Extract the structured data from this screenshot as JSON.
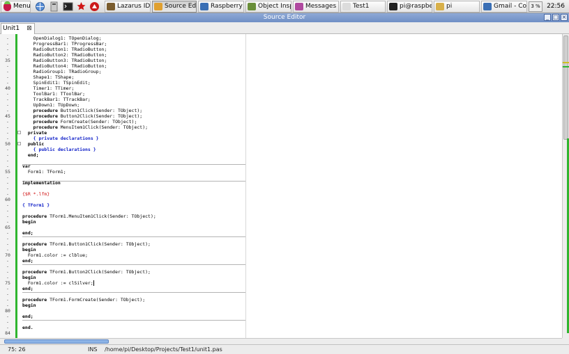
{
  "taskbar": {
    "menu_label": "Menu",
    "windows": [
      {
        "label": "Lazarus IDE...",
        "active": false,
        "icon": "lazarus-icon",
        "color": "#7a5c2e"
      },
      {
        "label": "Source Editor",
        "active": true,
        "icon": "source-editor-icon",
        "color": "#e0a030"
      },
      {
        "label": "Raspberry ...",
        "active": false,
        "icon": "browser-icon",
        "color": "#3a6fb5"
      },
      {
        "label": "Object Insp...",
        "active": false,
        "icon": "object-inspector-icon",
        "color": "#6a8f3a"
      },
      {
        "label": "Messages",
        "active": false,
        "icon": "messages-icon",
        "color": "#b04aa0"
      },
      {
        "label": "Test1",
        "active": false,
        "icon": "form-icon",
        "color": "#dcdcdc"
      },
      {
        "label": "pi@raspber...",
        "active": false,
        "icon": "terminal-icon",
        "color": "#222222"
      },
      {
        "label": "pi",
        "active": false,
        "icon": "folder-icon",
        "color": "#d8b04a"
      },
      {
        "label": "Gmail - Co...",
        "active": false,
        "icon": "browser-icon",
        "color": "#3a6fb5"
      }
    ],
    "cpu_label": "3 %",
    "clock": "22:56"
  },
  "window": {
    "title": "Source Editor"
  },
  "tab": {
    "label": "Unit1"
  },
  "editor": {
    "lines": [
      {
        "num": "-",
        "text": "    OpenDialog1: TOpenDialog;",
        "style": "plain"
      },
      {
        "num": "-",
        "text": "    ProgressBar1: TProgressBar;",
        "style": "plain"
      },
      {
        "num": "-",
        "text": "    RadioButton1: TRadioButton;",
        "style": "plain"
      },
      {
        "num": "-",
        "text": "    RadioButton2: TRadioButton;",
        "style": "plain"
      },
      {
        "num": "35",
        "text": "    RadioButton3: TRadioButton;",
        "style": "plain"
      },
      {
        "num": "-",
        "text": "    RadioButton4: TRadioButton;",
        "style": "plain"
      },
      {
        "num": "-",
        "text": "    RadioGroup1: TRadioGroup;",
        "style": "plain"
      },
      {
        "num": "-",
        "text": "    Shape1: TShape;",
        "style": "plain"
      },
      {
        "num": "-",
        "text": "    SpinEdit1: TSpinEdit;",
        "style": "plain"
      },
      {
        "num": "40",
        "text": "    Timer1: TTimer;",
        "style": "plain"
      },
      {
        "num": "-",
        "text": "    ToolBar1: TToolBar;",
        "style": "plain"
      },
      {
        "num": "-",
        "text": "    TrackBar1: TTrackBar;",
        "style": "plain"
      },
      {
        "num": "-",
        "text": "    UpDown1: TUpDown;",
        "style": "plain"
      },
      {
        "num": "-",
        "text": "    procedure Button1Click(Sender: TObject);",
        "style": "proc"
      },
      {
        "num": "45",
        "text": "    procedure Button2Click(Sender: TObject);",
        "style": "proc"
      },
      {
        "num": "-",
        "text": "    procedure FormCreate(Sender: TObject);",
        "style": "proc"
      },
      {
        "num": "-",
        "text": "    procedure MenuItem1Click(Sender: TObject);",
        "style": "proc"
      },
      {
        "num": "-",
        "text": "  private",
        "style": "kw",
        "fold": true
      },
      {
        "num": "-",
        "text": "    { private declarations }",
        "style": "cm"
      },
      {
        "num": "50",
        "text": "  public",
        "style": "kw",
        "fold": true
      },
      {
        "num": "-",
        "text": "    { public declarations }",
        "style": "cm"
      },
      {
        "num": "-",
        "text": "  end;",
        "style": "kw"
      },
      {
        "num": "-",
        "text": "",
        "style": "plain",
        "sep": true
      },
      {
        "num": "-",
        "text": "var",
        "style": "kw"
      },
      {
        "num": "55",
        "text": "  Form1: TForm1;",
        "style": "plain"
      },
      {
        "num": "-",
        "text": "",
        "style": "plain",
        "sep": true
      },
      {
        "num": "-",
        "text": "implementation",
        "style": "kw"
      },
      {
        "num": "-",
        "text": "",
        "style": "plain"
      },
      {
        "num": "-",
        "text": "{$R *.lfm}",
        "style": "dr"
      },
      {
        "num": "60",
        "text": "",
        "style": "plain"
      },
      {
        "num": "-",
        "text": "{ TForm1 }",
        "style": "cm"
      },
      {
        "num": "-",
        "text": "",
        "style": "plain"
      },
      {
        "num": "-",
        "text": "procedure TForm1.MenuItem1Click(Sender: TObject);",
        "style": "proc"
      },
      {
        "num": "-",
        "text": "begin",
        "style": "kw"
      },
      {
        "num": "65",
        "text": "",
        "style": "plain"
      },
      {
        "num": "-",
        "text": "end;",
        "style": "kw",
        "sep": true
      },
      {
        "num": "-",
        "text": "",
        "style": "plain"
      },
      {
        "num": "-",
        "text": "procedure TForm1.Button1Click(Sender: TObject);",
        "style": "proc"
      },
      {
        "num": "-",
        "text": "begin",
        "style": "kw"
      },
      {
        "num": "70",
        "text": "  Form1.color := clblue;",
        "style": "plain"
      },
      {
        "num": "-",
        "text": "end;",
        "style": "kw",
        "sep": true
      },
      {
        "num": "-",
        "text": "",
        "style": "plain"
      },
      {
        "num": "-",
        "text": "procedure TForm1.Button2Click(Sender: TObject);",
        "style": "proc"
      },
      {
        "num": "-",
        "text": "begin",
        "style": "kw"
      },
      {
        "num": "75",
        "text": "  Form1.color := clSilver;",
        "style": "plain",
        "caret": true
      },
      {
        "num": "-",
        "text": "end;",
        "style": "kw",
        "sep": true
      },
      {
        "num": "-",
        "text": "",
        "style": "plain"
      },
      {
        "num": "-",
        "text": "procedure TForm1.FormCreate(Sender: TObject);",
        "style": "proc"
      },
      {
        "num": "-",
        "text": "begin",
        "style": "kw"
      },
      {
        "num": "80",
        "text": "",
        "style": "plain"
      },
      {
        "num": "-",
        "text": "end;",
        "style": "kw",
        "sep": true
      },
      {
        "num": "-",
        "text": "",
        "style": "plain"
      },
      {
        "num": "-",
        "text": "end.",
        "style": "kw"
      },
      {
        "num": "84",
        "text": "",
        "style": "plain"
      }
    ],
    "changebar_color": "#2fb52f",
    "keyword_color": "#000000",
    "comment_color": "#1020c8",
    "directive_color": "#d01010"
  },
  "statusbar": {
    "position": "75: 26",
    "mode": "INS",
    "file_path": "/home/pi/Desktop/Projects/Test1/unit1.pas"
  }
}
